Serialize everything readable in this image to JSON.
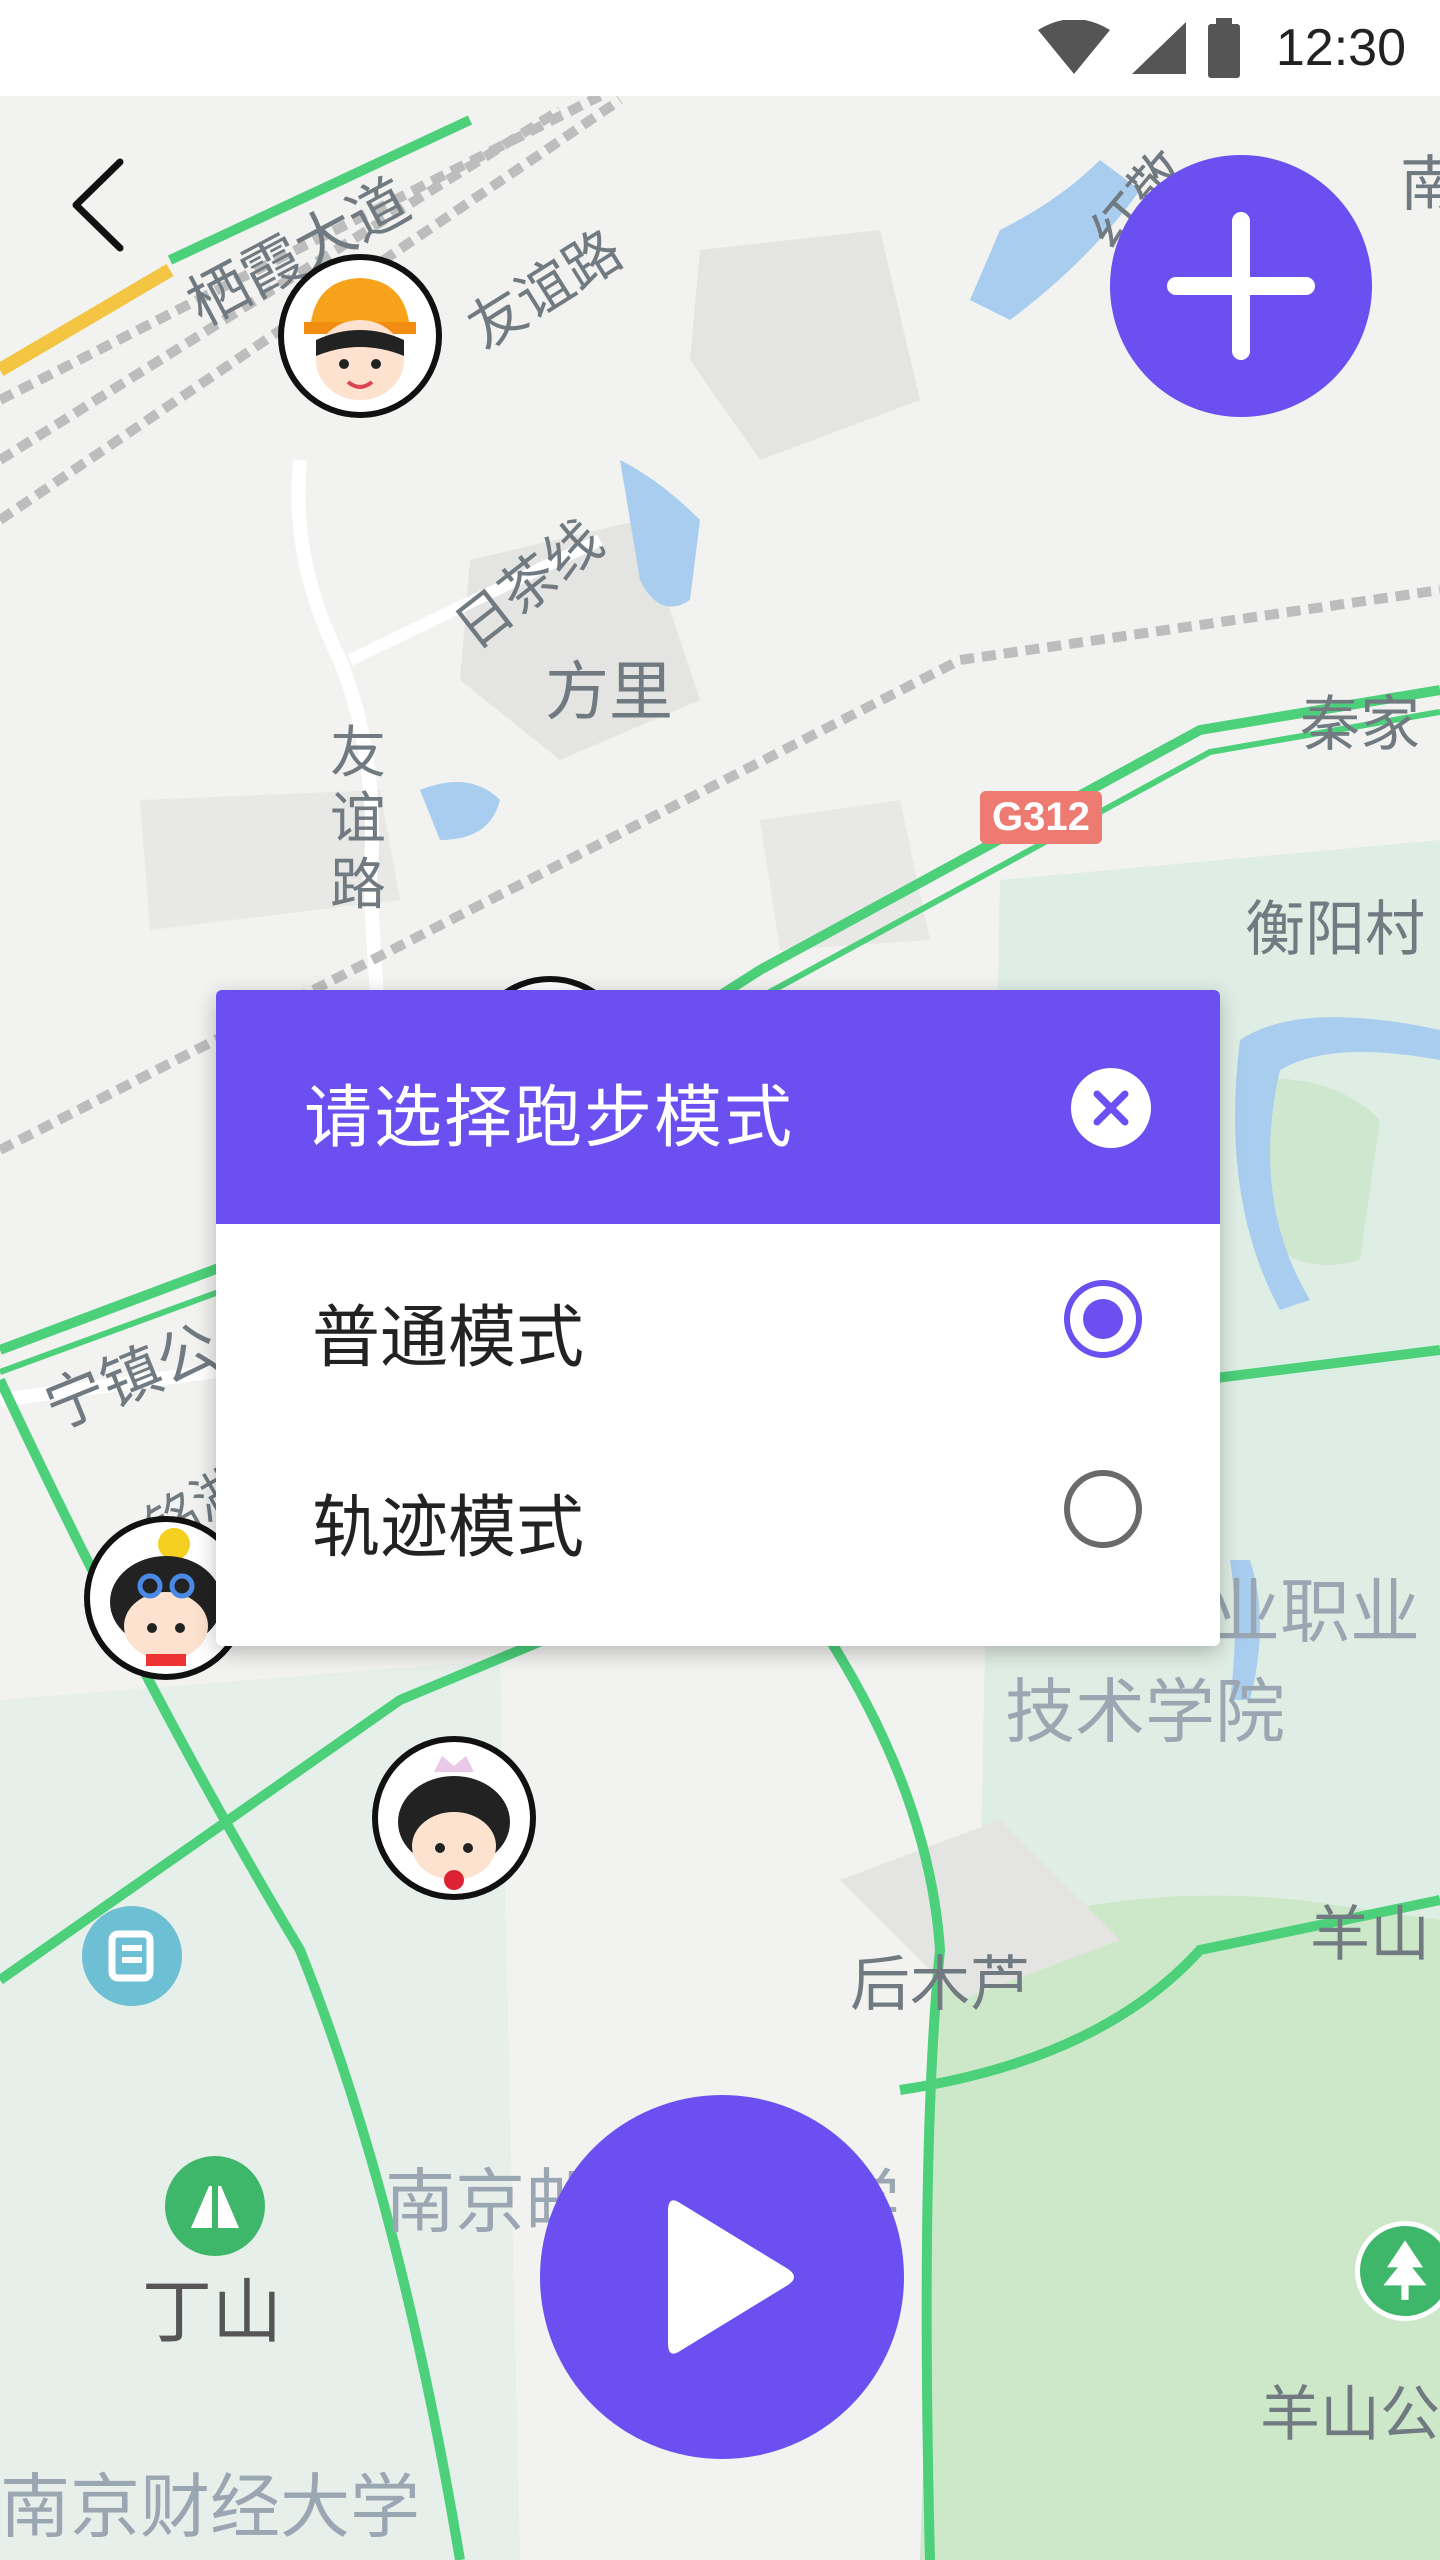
{
  "status_bar": {
    "time": "12:30"
  },
  "map": {
    "labels": {
      "qixia_road": "栖霞大道",
      "youyi_road_top": "友谊路",
      "hongjing": "红敬",
      "nan_top_right": "南",
      "richa_line": "日茶线",
      "fangli": "方里",
      "youyi_road_vertical": "友谊路",
      "road_badge": "G312",
      "qinjia": "秦家",
      "hengyang": "衡阳村",
      "ningzhen": "宁镇公",
      "minghu": "铭湖",
      "vocational_college_1": "业职业",
      "vocational_college_2": "技术学院",
      "yangshan_right": "羊山",
      "houmulu": "后木芦",
      "nanjing_university_partial": "南京邮",
      "nanjing_university_suffix": "学",
      "dingshan": "丁山",
      "yangshan_park": "羊山公",
      "nanjing_finance": "南京财经大学"
    }
  },
  "dialog": {
    "title": "请选择跑步模式",
    "options": [
      {
        "label": "普通模式",
        "selected": true
      },
      {
        "label": "轨迹模式",
        "selected": false
      }
    ]
  },
  "colors": {
    "accent": "#6b4ff0",
    "road_green": "#4cd07a",
    "water": "#a9cdef",
    "park": "#cde8c9"
  },
  "icons": {
    "back": "chevron-left-icon",
    "add": "plus-icon",
    "close": "close-icon",
    "play": "play-icon"
  }
}
